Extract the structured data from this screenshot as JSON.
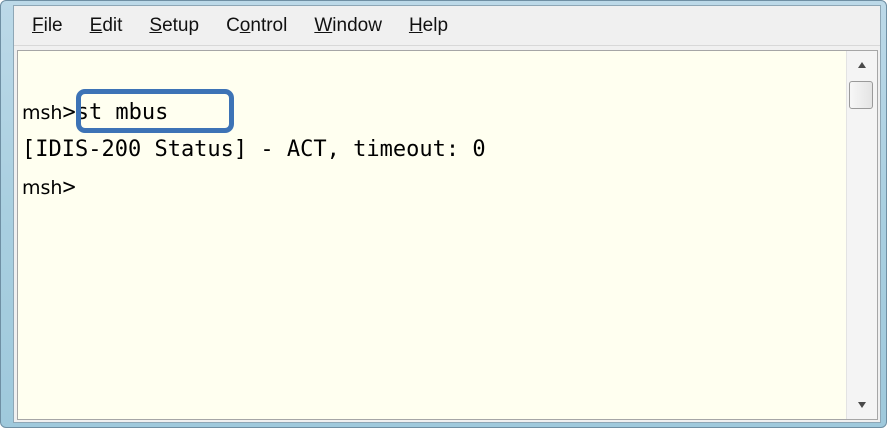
{
  "menu": {
    "items": [
      {
        "mnemonic": "F",
        "rest": "ile"
      },
      {
        "mnemonic": "E",
        "rest": "dit"
      },
      {
        "mnemonic": "S",
        "rest": "etup"
      },
      {
        "pre": "C",
        "mnemonic": "o",
        "rest": "ntrol"
      },
      {
        "mnemonic": "W",
        "rest": "indow"
      },
      {
        "mnemonic": "H",
        "rest": "elp"
      }
    ]
  },
  "console": {
    "lines": [
      {
        "prompt": "msh",
        "text": ">st mbus"
      },
      {
        "prompt": "",
        "text": "[IDIS-200 Status] - ACT, timeout: 0"
      },
      {
        "prompt": "msh",
        "text": ">"
      }
    ]
  },
  "scrollbar": {
    "up_icon": "triangle-up-icon",
    "down_icon": "triangle-down-icon"
  },
  "colors": {
    "console_background": "#fffff0",
    "highlight_border": "#3d73b6",
    "frame": "#a9cfe0"
  }
}
